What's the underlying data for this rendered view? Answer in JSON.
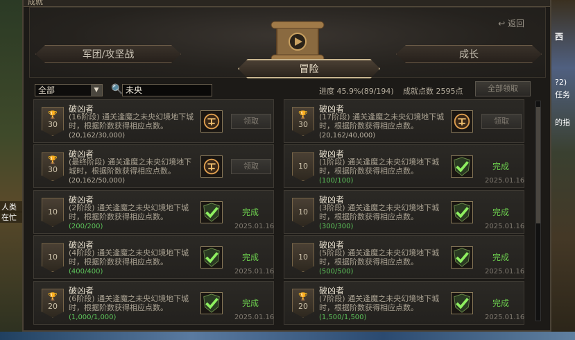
{
  "window": {
    "title": "成就",
    "back": "返回"
  },
  "tabs": {
    "left": "军团/攻坚战",
    "center": "冒险",
    "right": "成长"
  },
  "filter": {
    "category": "全部",
    "search": "未央"
  },
  "stats": {
    "progress": "进度 45.9%(89/194)",
    "points": "成就点数 2595点",
    "claim_all": "全部领取"
  },
  "side_text": {
    "left_1": "人类",
    "left_2": "在忙",
    "right_1": "西",
    "right_2": "?2)",
    "right_3": "任务",
    "right_4": "的指"
  },
  "achievements": [
    {
      "points": "30",
      "trophy": true,
      "title": "破凶者",
      "desc": "(16阶段) 通关逢魔之未央幻境地下城时，根据阶数获得相应点数。",
      "progress": "(20,162/30,000)",
      "complete": false,
      "claim": "领取",
      "date": ""
    },
    {
      "points": "30",
      "trophy": true,
      "title": "破凶者",
      "desc": "(17阶段) 通关逢魔之未央幻境地下城时，根据阶数获得相应点数。",
      "progress": "(20,162/40,000)",
      "complete": false,
      "claim": "领取",
      "date": ""
    },
    {
      "points": "30",
      "trophy": true,
      "title": "破凶者",
      "desc": "(最终阶段) 通关逢魔之未央幻境地下城时，根据阶数获得相应点数。",
      "progress": "(20,162/50,000)",
      "complete": false,
      "claim": "领取",
      "date": ""
    },
    {
      "points": "10",
      "trophy": false,
      "title": "破凶者",
      "desc": "(1阶段) 通关逢魔之未央幻境地下城时，根据阶数获得相应点数。",
      "progress": "(100/100)",
      "complete": true,
      "claim": "完成",
      "date": "2025.01.16"
    },
    {
      "points": "10",
      "trophy": false,
      "title": "破凶者",
      "desc": "(2阶段) 通关逢魔之未央幻境地下城时，根据阶数获得相应点数。",
      "progress": "(200/200)",
      "complete": true,
      "claim": "完成",
      "date": "2025.01.16"
    },
    {
      "points": "10",
      "trophy": false,
      "title": "破凶者",
      "desc": "(3阶段) 通关逢魔之未央幻境地下城时，根据阶数获得相应点数。",
      "progress": "(300/300)",
      "complete": true,
      "claim": "完成",
      "date": "2025.01.16"
    },
    {
      "points": "10",
      "trophy": false,
      "title": "破凶者",
      "desc": "(4阶段) 通关逢魔之未央幻境地下城时，根据阶数获得相应点数。",
      "progress": "(400/400)",
      "complete": true,
      "claim": "完成",
      "date": "2025.01.16"
    },
    {
      "points": "10",
      "trophy": false,
      "title": "破凶者",
      "desc": "(5阶段) 通关逢魔之未央幻境地下城时，根据阶数获得相应点数。",
      "progress": "(500/500)",
      "complete": true,
      "claim": "完成",
      "date": "2025.01.16"
    },
    {
      "points": "20",
      "trophy": true,
      "title": "破凶者",
      "desc": "(6阶段) 通关逢魔之未央幻境地下城时，根据阶数获得相应点数。",
      "progress": "(1,000/1,000)",
      "complete": true,
      "claim": "完成",
      "date": "2025.01.16"
    },
    {
      "points": "20",
      "trophy": true,
      "title": "破凶者",
      "desc": "(7阶段) 通关逢魔之未央幻境地下城时，根据阶数获得相应点数。",
      "progress": "(1,500/1,500)",
      "complete": true,
      "claim": "完成",
      "date": "2025.01.16"
    }
  ]
}
